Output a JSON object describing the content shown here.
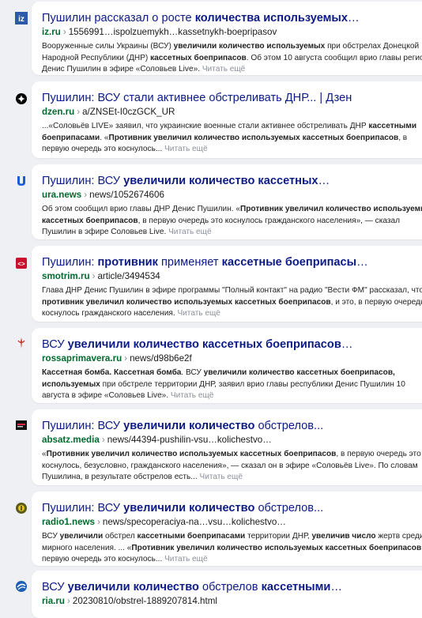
{
  "results": [
    {
      "title": [
        {
          "t": "Пушилин рассказал о росте ",
          "b": false
        },
        {
          "t": "количества используемых",
          "b": true
        },
        {
          "t": "…",
          "b": false
        }
      ],
      "host": "iz.ru",
      "path": "1556991…ispolzuemykh…kassetnykh-boepripasov",
      "favicon": "iz-icon",
      "snippet": [
        {
          "t": "Вооруженные силы Украины (ВСУ) ",
          "b": false
        },
        {
          "t": "увеличили количество используемых",
          "b": true
        },
        {
          "t": " при обстрелах Донецкой Народной Республики (ДНР) ",
          "b": false
        },
        {
          "t": "кассетных боеприпасов",
          "b": true
        },
        {
          "t": ". Об этом 10 августа сообщил врио главы региона Денис Пушилин в эфире «Соловьев Live».",
          "b": false
        }
      ],
      "more": "Читать ещё"
    },
    {
      "title": [
        {
          "t": "Пушилин: ВСУ стали активнее обстреливать ДНР... | Дзен",
          "b": false
        }
      ],
      "host": "dzen.ru",
      "path": "a/ZNSEt-I0czGCK_UR",
      "favicon": "dzen-icon",
      "snippet": [
        {
          "t": "...«Соловьёв LIVE» заявил, что украинские военные стали активнее обстреливать ДНР ",
          "b": false
        },
        {
          "t": "кассетными боеприпасами",
          "b": true
        },
        {
          "t": ". «",
          "b": false
        },
        {
          "t": "Противник увеличил количество используемых кассетных боеприпасов",
          "b": true
        },
        {
          "t": ", в первую очередь это коснулось...",
          "b": false
        }
      ],
      "more": "Читать ещё"
    },
    {
      "title": [
        {
          "t": "Пушилин: ВСУ ",
          "b": false
        },
        {
          "t": "увеличили количество кассетных",
          "b": true
        },
        {
          "t": "…",
          "b": false
        }
      ],
      "host": "ura.news",
      "path": "news/1052674606",
      "favicon": "ura-icon",
      "snippet": [
        {
          "t": "Об этом сообщил врио главы ДНР Денис Пушилин. «",
          "b": false
        },
        {
          "t": "Противник увеличил количество используемых кассетных боеприпасов",
          "b": true
        },
        {
          "t": ", в первую очередь это коснулось гражданского населения», — сказал Пушилин в эфире Соловьев Live.",
          "b": false
        }
      ],
      "more": "Читать ещё"
    },
    {
      "title": [
        {
          "t": "Пушилин: ",
          "b": false
        },
        {
          "t": "противник",
          "b": true
        },
        {
          "t": " применяет ",
          "b": false
        },
        {
          "t": "кассетные боеприпасы",
          "b": true
        },
        {
          "t": "…",
          "b": false
        }
      ],
      "host": "smotrim.ru",
      "path": "article/3494534",
      "favicon": "smotrim-icon",
      "snippet": [
        {
          "t": "Глава ДНР Денис Пушилин в эфире программы \"Полный контакт\" на радио \"Вести ФМ\" рассказал, что ",
          "b": false
        },
        {
          "t": "противник увеличил количество используемых кассетных боеприпасов",
          "b": true
        },
        {
          "t": ", и это, в первую очередь, коснулось гражданского населения.",
          "b": false
        }
      ],
      "more": "Читать ещё"
    },
    {
      "title": [
        {
          "t": "ВСУ ",
          "b": false
        },
        {
          "t": "увеличили количество кассетных боеприпасов",
          "b": true
        },
        {
          "t": "…",
          "b": false
        }
      ],
      "host": "rossaprimavera.ru",
      "path": "news/d98b6e2f",
      "favicon": "rossaprimavera-icon",
      "snippet": [
        {
          "t": "Кассетная бомба. Кассетная бомба",
          "b": true
        },
        {
          "t": ". ВСУ ",
          "b": false
        },
        {
          "t": "увеличили количество кассетных боеприпасов, используемых",
          "b": true
        },
        {
          "t": " при обстреле территории ДНР, заявил врио главы республики Денис Пушилин 10 августа в эфире «Соловьев Live».",
          "b": false
        }
      ],
      "more": "Читать ещё"
    },
    {
      "title": [
        {
          "t": "Пушилин: ВСУ ",
          "b": false
        },
        {
          "t": "увеличили количество",
          "b": true
        },
        {
          "t": " обстрелов...",
          "b": false
        }
      ],
      "host": "absatz.media",
      "path": "news/44394-pushilin-vsu…kolichestvo…",
      "favicon": "absatz-icon",
      "snippet": [
        {
          "t": "«",
          "b": false
        },
        {
          "t": "Противник увеличил количество используемых кассетных боеприпасов",
          "b": true
        },
        {
          "t": ", в первую очередь это коснулось, безусловно, гражданского населения», — сказал он в эфире «Соловьёв Live». По словам Пушилина, в результате обстрелов есть...",
          "b": false
        }
      ],
      "more": "Читать ещё"
    },
    {
      "title": [
        {
          "t": "Пушилин: ВСУ ",
          "b": false
        },
        {
          "t": "увеличили количество",
          "b": true
        },
        {
          "t": " обстрелов...",
          "b": false
        }
      ],
      "host": "radio1.news",
      "path": "news/specoperaciya-na…vsu…kolichestvo…",
      "favicon": "radio1-icon",
      "snippet": [
        {
          "t": "ВСУ ",
          "b": false
        },
        {
          "t": "увеличили",
          "b": true
        },
        {
          "t": " обстрел ",
          "b": false
        },
        {
          "t": "кассетными боеприпасами",
          "b": true
        },
        {
          "t": " территории ДНР, ",
          "b": false
        },
        {
          "t": "увеличив число",
          "b": true
        },
        {
          "t": " жертв среди мирного населения. ... «",
          "b": false
        },
        {
          "t": "Противник увеличил количество используемых кассетных боеприпасов",
          "b": true
        },
        {
          "t": ", в первую очередь это коснулось...",
          "b": false
        }
      ],
      "more": "Читать ещё"
    },
    {
      "title": [
        {
          "t": "ВСУ ",
          "b": false
        },
        {
          "t": "увеличили количество",
          "b": true
        },
        {
          "t": " обстрелов ",
          "b": false
        },
        {
          "t": "кассетными",
          "b": true
        },
        {
          "t": "…",
          "b": false
        }
      ],
      "host": "ria.ru",
      "path": "20230810/obstrel-1889207814.html",
      "favicon": "ria-icon",
      "snippet": [],
      "more": ""
    }
  ]
}
